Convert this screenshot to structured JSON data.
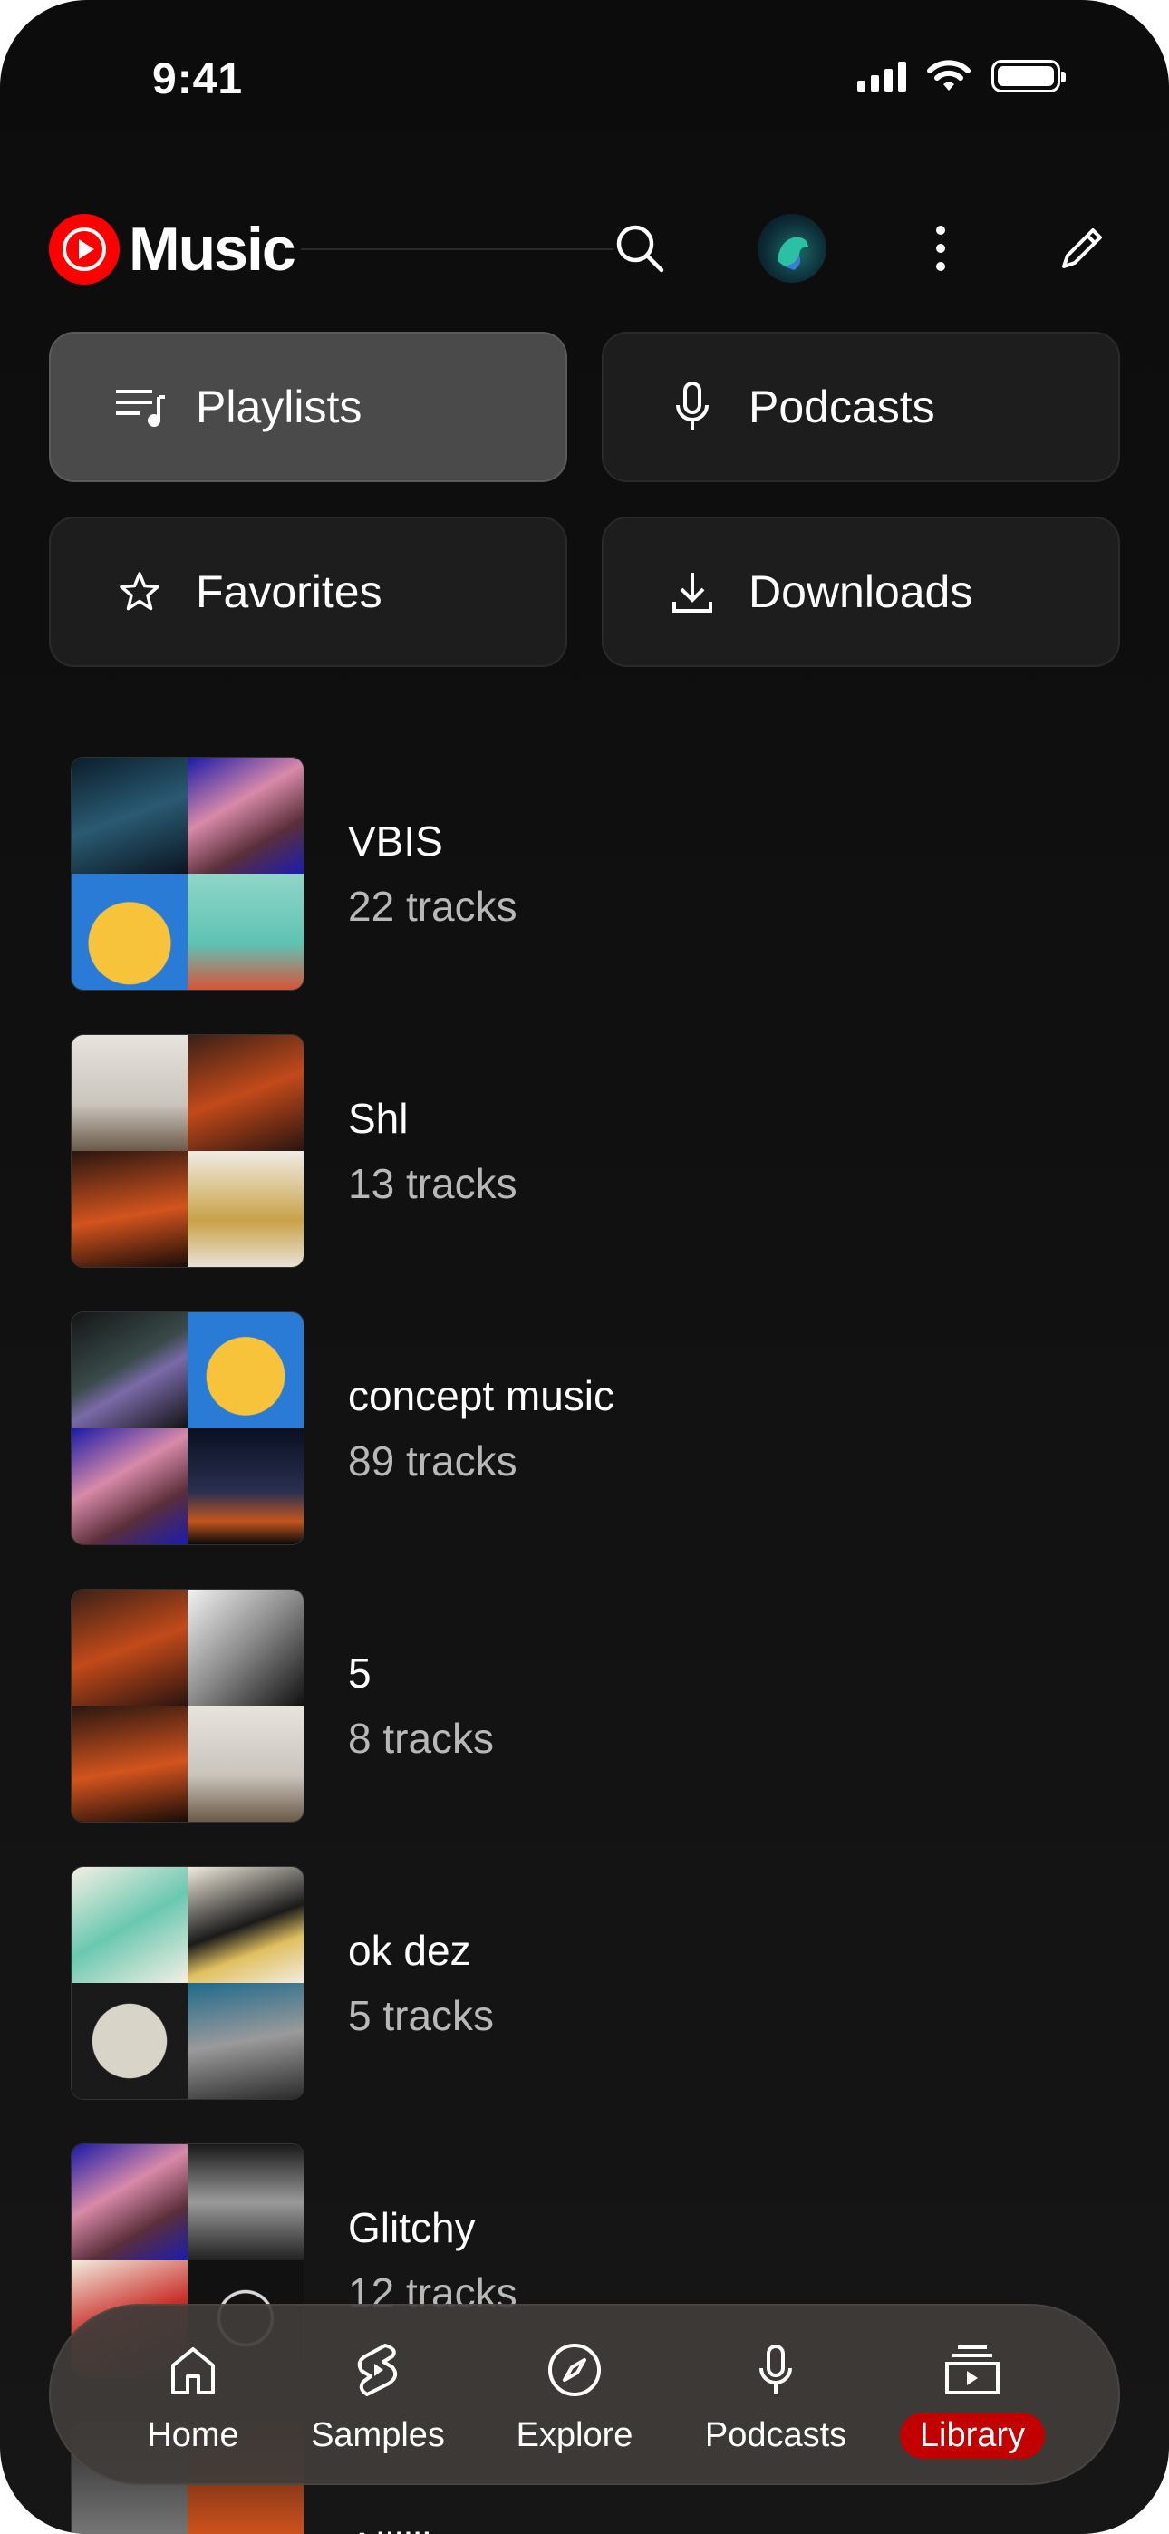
{
  "status_bar": {
    "time": "9:41"
  },
  "app": {
    "name": "Music"
  },
  "chips": [
    {
      "label": "Playlists",
      "icon": "playlist-icon",
      "active": true
    },
    {
      "label": "Podcasts",
      "icon": "microphone-icon",
      "active": false
    },
    {
      "label": "Favorites",
      "icon": "star-icon",
      "active": false
    },
    {
      "label": "Downloads",
      "icon": "download-icon",
      "active": false
    }
  ],
  "playlists": [
    {
      "title": "VBIS",
      "subtitle": "22 tracks"
    },
    {
      "title": "Shl",
      "subtitle": "13 tracks"
    },
    {
      "title": "concept music",
      "subtitle": "89 tracks"
    },
    {
      "title": "5",
      "subtitle": "8 tracks"
    },
    {
      "title": "ok dez",
      "subtitle": "5 tracks"
    },
    {
      "title": "Glitchy",
      "subtitle": "12 tracks"
    },
    {
      "title": "Allllll",
      "subtitle": ""
    }
  ],
  "nav": [
    {
      "label": "Home",
      "icon": "home-icon"
    },
    {
      "label": "Samples",
      "icon": "samples-icon"
    },
    {
      "label": "Explore",
      "icon": "compass-icon"
    },
    {
      "label": "Podcasts",
      "icon": "microphone-icon"
    },
    {
      "label": "Library",
      "icon": "library-icon",
      "active": true
    }
  ],
  "colors": {
    "accent": "#ff0000",
    "active_nav": "#c30000",
    "background": "#0e0e0e"
  }
}
